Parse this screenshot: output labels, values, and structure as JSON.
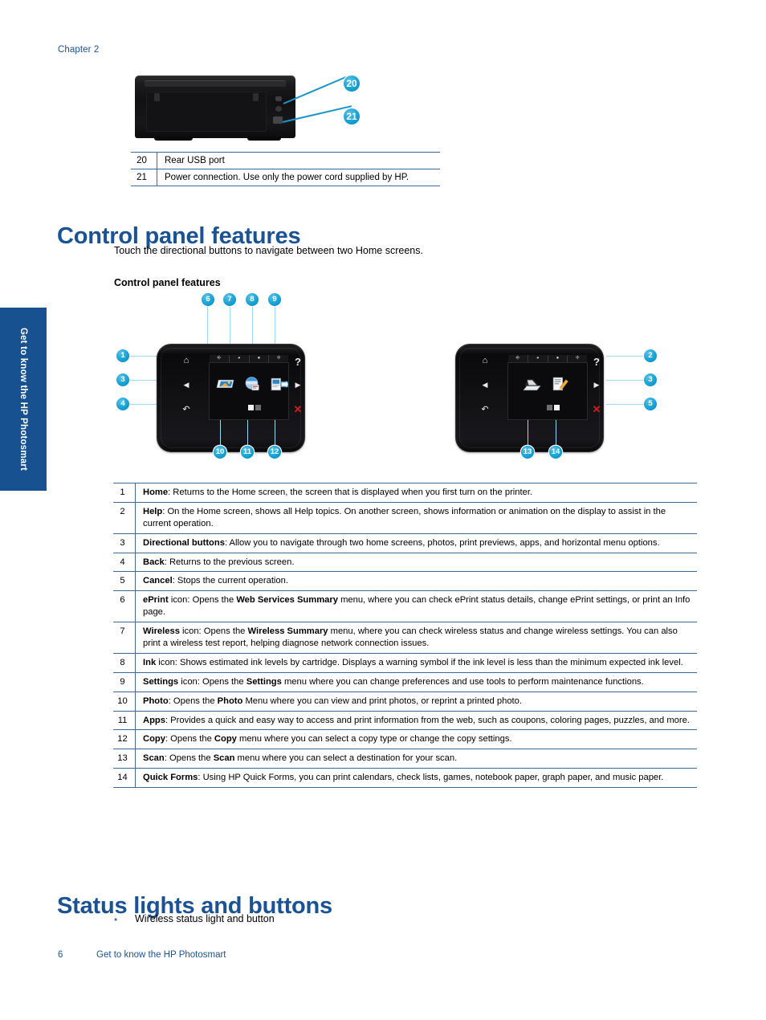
{
  "page": {
    "chapter_label": "Chapter 2",
    "side_tab_label": "Get to know the HP Photosmart",
    "footer_page_number": "6",
    "footer_text": "Get to know the HP Photosmart",
    "accent_heading_color": "#1a5293",
    "accent_tab_color": "#17518f",
    "callout_color": "#17a3d6",
    "table_border_color": "#41688f"
  },
  "rear_figure": {
    "callouts": [
      {
        "id": "20",
        "label": "20"
      },
      {
        "id": "21",
        "label": "21"
      }
    ]
  },
  "rear_table": {
    "rows": [
      {
        "num": "20",
        "desc": "Rear USB port"
      },
      {
        "num": "21",
        "desc": "Power connection. Use only the power cord supplied by HP."
      }
    ]
  },
  "sections": {
    "control_panel_features": {
      "heading": "Control panel features",
      "intro": "Touch the directional buttons to navigate between two Home screens.",
      "figure_caption": "Control panel features"
    },
    "status_lights_and_buttons": {
      "heading": "Status lights and buttons",
      "bullets": [
        "Wireless status light and button"
      ]
    }
  },
  "control_panel_figure": {
    "left_panel": {
      "hardware_buttons": [
        {
          "name": "home",
          "glyph": "⌂",
          "callout": "1"
        },
        {
          "name": "left-arrow",
          "glyph": "◀",
          "callout": "3"
        },
        {
          "name": "back",
          "glyph": "↶",
          "callout": "4"
        },
        {
          "name": "help",
          "glyph": "?",
          "callout": ""
        },
        {
          "name": "right-arrow",
          "glyph": "▶",
          "callout": ""
        },
        {
          "name": "cancel",
          "glyph": "✕",
          "callout": ""
        }
      ],
      "status_bar_icons": [
        {
          "name": "eprint",
          "callout": "6"
        },
        {
          "name": "wireless",
          "callout": "7"
        },
        {
          "name": "ink",
          "callout": "8"
        },
        {
          "name": "settings",
          "callout": "9"
        }
      ],
      "screen_icons": [
        {
          "name": "photo",
          "callout": "10"
        },
        {
          "name": "apps",
          "callout": "11"
        },
        {
          "name": "copy",
          "callout": "12"
        }
      ]
    },
    "right_panel": {
      "hardware_buttons": [
        {
          "name": "home",
          "glyph": "⌂",
          "callout": ""
        },
        {
          "name": "left-arrow",
          "glyph": "◀",
          "callout": ""
        },
        {
          "name": "back",
          "glyph": "↶",
          "callout": ""
        },
        {
          "name": "help",
          "glyph": "?",
          "callout": "2"
        },
        {
          "name": "right-arrow",
          "glyph": "▶",
          "callout": "3"
        },
        {
          "name": "cancel",
          "glyph": "✕",
          "callout": "5"
        }
      ],
      "screen_icons": [
        {
          "name": "scan",
          "callout": "13"
        },
        {
          "name": "quick-forms",
          "callout": "14"
        }
      ]
    }
  },
  "features_table": {
    "rows": [
      {
        "num": "1",
        "term": "Home",
        "rest": ": Returns to the Home screen, the screen that is displayed when you first turn on the printer."
      },
      {
        "num": "2",
        "term": "Help",
        "rest": ": On the Home screen, shows all Help topics. On another screen, shows information or animation on the display to assist in the current operation."
      },
      {
        "num": "3",
        "term": "Directional buttons",
        "rest": ": Allow you to navigate through two home screens, photos, print previews, apps, and horizontal menu options."
      },
      {
        "num": "4",
        "term": "Back",
        "rest": ": Returns to the previous screen."
      },
      {
        "num": "5",
        "term": "Cancel",
        "rest": ": Stops the current operation."
      },
      {
        "num": "6",
        "term": "ePrint",
        "rest": " icon: Opens the ",
        "term2": "Web Services Summary",
        "rest2": " menu, where you can check ePrint status details, change ePrint settings, or print an Info page."
      },
      {
        "num": "7",
        "term": "Wireless",
        "rest": " icon: Opens the ",
        "term2": "Wireless Summary",
        "rest2": " menu, where you can check wireless status and change wireless settings. You can also print a wireless test report, helping diagnose network connection issues."
      },
      {
        "num": "8",
        "term": "Ink",
        "rest": " icon: Shows estimated ink levels by cartridge. Displays a warning symbol if the ink level is less than the minimum expected ink level."
      },
      {
        "num": "9",
        "term": "Settings",
        "rest": " icon: Opens the ",
        "term2": "Settings",
        "rest2": " menu where you can change preferences and use tools to perform maintenance functions."
      },
      {
        "num": "10",
        "term": "Photo",
        "rest": ": Opens the ",
        "term2": "Photo",
        "rest2": " Menu where you can view and print photos, or reprint a printed photo."
      },
      {
        "num": "11",
        "term": "Apps",
        "rest": ": Provides a quick and easy way to access and print information from the web, such as coupons, coloring pages, puzzles, and more."
      },
      {
        "num": "12",
        "term": "Copy",
        "rest": ": Opens the ",
        "term2": "Copy",
        "rest2": " menu where you can select a copy type or change the copy settings."
      },
      {
        "num": "13",
        "term": "Scan",
        "rest": ": Opens the ",
        "term2": "Scan",
        "rest2": " menu where you can select a destination for your scan."
      },
      {
        "num": "14",
        "term": "Quick Forms",
        "rest": ": Using HP Quick Forms, you can print calendars, check lists, games, notebook paper, graph paper, and music paper."
      }
    ]
  }
}
